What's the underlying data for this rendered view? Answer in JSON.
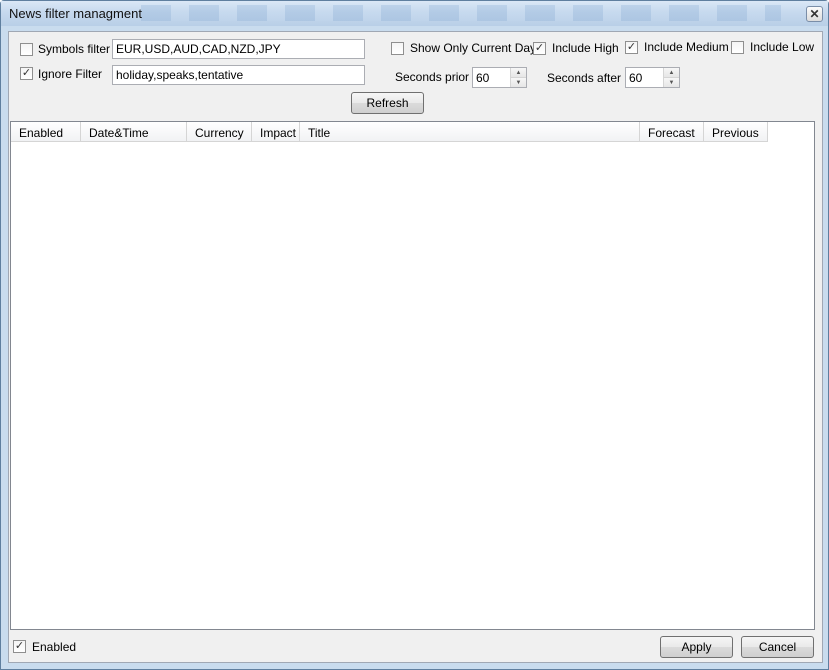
{
  "window": {
    "title": "News filter managment",
    "close_glyph": "✕"
  },
  "filters": {
    "symbols": {
      "label": "Symbols filter",
      "checked": false,
      "value": "EUR,USD,AUD,CAD,NZD,JPY"
    },
    "ignore": {
      "label": "Ignore Filter",
      "checked": true,
      "value": "holiday,speaks,tentative"
    }
  },
  "options": {
    "current_day": {
      "label": "Show Only Current Day",
      "checked": false
    },
    "include_high": {
      "label": "Include High",
      "checked": true
    },
    "include_medium": {
      "label": "Include Medium",
      "checked": true
    },
    "include_low": {
      "label": "Include Low",
      "checked": false
    }
  },
  "timing": {
    "seconds_prior": {
      "label": "Seconds prior",
      "value": "60"
    },
    "seconds_after": {
      "label": "Seconds after",
      "value": "60"
    }
  },
  "refresh_label": "Refresh",
  "table": {
    "columns": [
      "Enabled",
      "Date&Time",
      "Currency",
      "Impact",
      "Title",
      "Forecast",
      "Previous"
    ]
  },
  "footer": {
    "enabled": {
      "label": "Enabled",
      "checked": true
    },
    "apply_label": "Apply",
    "cancel_label": "Cancel"
  },
  "check_glyph": "✓"
}
